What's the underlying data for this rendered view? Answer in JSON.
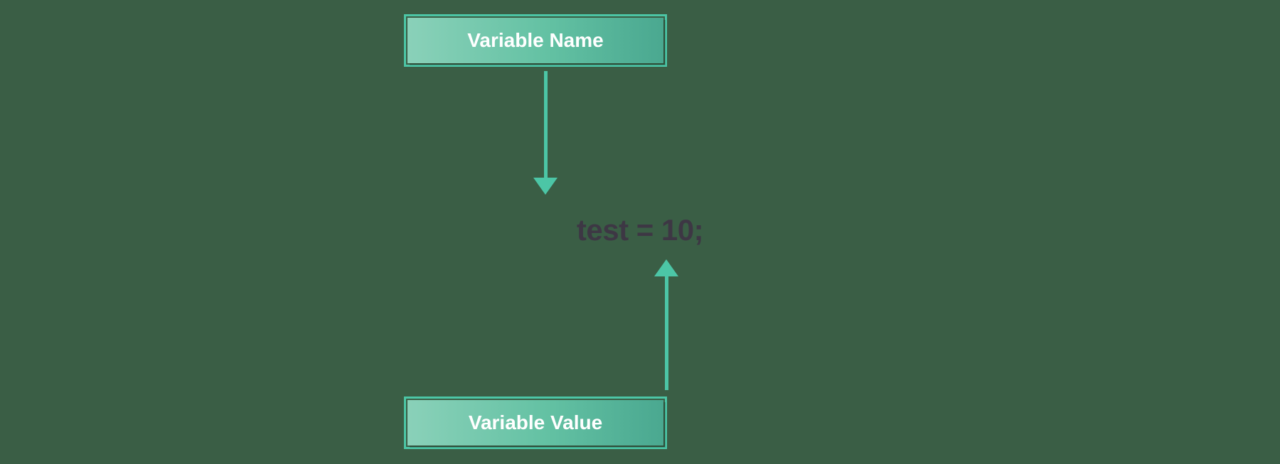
{
  "labels": {
    "top": "Variable Name",
    "bottom": "Variable Value"
  },
  "code": "test = 10;",
  "colors": {
    "accent": "#4cc6a6",
    "box_gradient_from": "#8ad1b9",
    "box_gradient_to": "#4aa890",
    "text": "#3d3744",
    "bg": "#3a5e45"
  }
}
